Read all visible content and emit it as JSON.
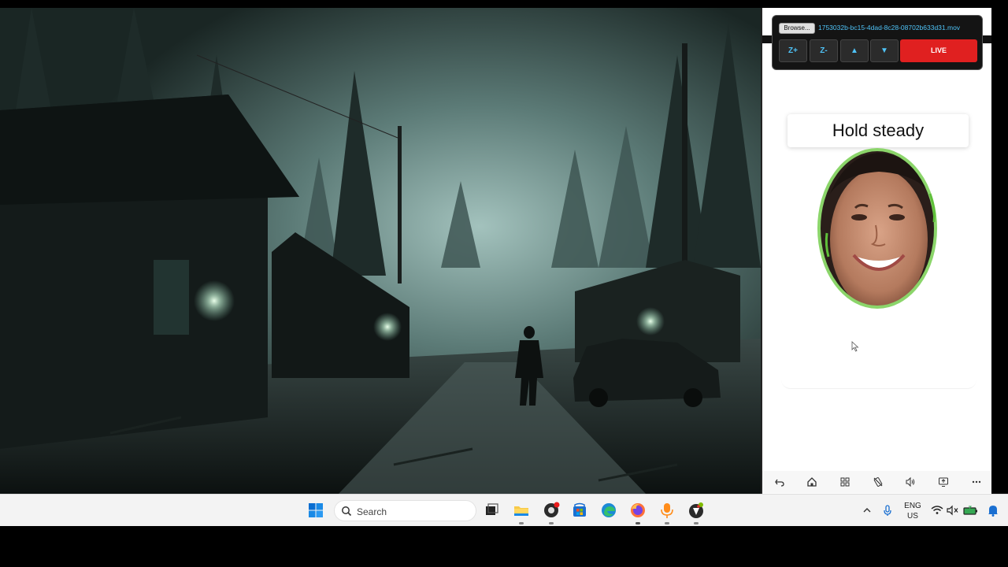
{
  "phone": {
    "control": {
      "browse_label": "Browse...",
      "file_name": "1753032b-bc15-4dad-8c28-08702b633d31.mov",
      "zoom_in_label": "Z+",
      "zoom_out_label": "Z-",
      "up_label": "▲",
      "down_label": "▼",
      "live_label": "LIVE"
    },
    "status_text": "Hold steady",
    "oval_color": "#8bd56a",
    "nav_icons": [
      "back-icon",
      "home-icon",
      "apps-icon",
      "rotate-off-icon",
      "volume-icon",
      "screen-icon",
      "more-icon"
    ]
  },
  "taskbar": {
    "search_placeholder": "Search",
    "lang_line1": "ENG",
    "lang_line2": "US",
    "apps": [
      "windows-start-icon",
      "search-icon",
      "task-view-icon",
      "file-explorer-icon",
      "obs-icon",
      "store-icon",
      "edge-icon",
      "firefox-icon",
      "microphone-app-icon",
      "inkscape-icon"
    ],
    "tray": [
      "chevron-up-icon",
      "mic-icon",
      "wifi-icon",
      "mute-icon",
      "battery-icon",
      "notification-bell-icon"
    ]
  },
  "colors": {
    "live": "#e02020",
    "accent": "#4fc3f7",
    "windows_blue": "#0a6ed1"
  }
}
